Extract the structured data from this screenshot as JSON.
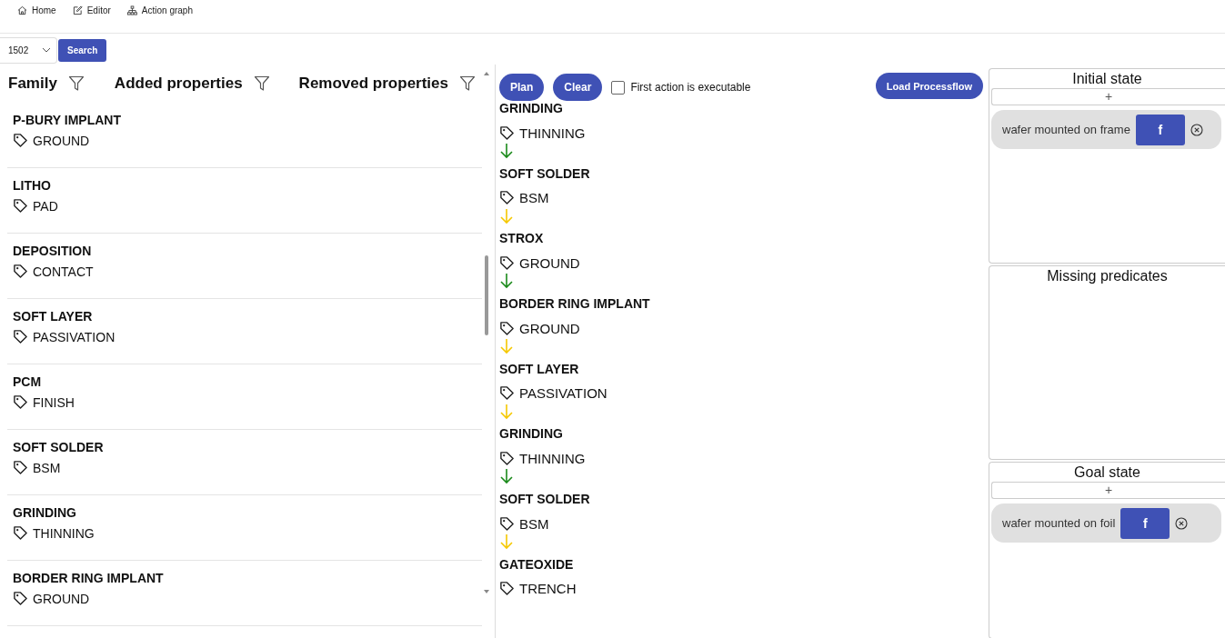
{
  "nav": [
    {
      "label": "Home"
    },
    {
      "label": "Editor"
    },
    {
      "label": "Action graph"
    }
  ],
  "search": {
    "value": "1502",
    "button": "Search"
  },
  "table": {
    "columns": [
      "Family",
      "Added properties",
      "Removed properties"
    ],
    "rows": [
      {
        "family": "P-BURY IMPLANT",
        "tag": "GROUND"
      },
      {
        "family": "LITHO",
        "tag": "PAD"
      },
      {
        "family": "DEPOSITION",
        "tag": "CONTACT"
      },
      {
        "family": "SOFT LAYER",
        "tag": "PASSIVATION"
      },
      {
        "family": "PCM",
        "tag": "FINISH"
      },
      {
        "family": "SOFT SOLDER",
        "tag": "BSM"
      },
      {
        "family": "GRINDING",
        "tag": "THINNING"
      },
      {
        "family": "BORDER RING IMPLANT",
        "tag": "GROUND"
      }
    ]
  },
  "toolbar": {
    "plan": "Plan",
    "clear": "Clear",
    "checkbox": {
      "label": "First action is executable",
      "checked": false
    },
    "load": "Load Processflow"
  },
  "plan_steps": [
    {
      "family": "GRINDING",
      "tag": "THINNING",
      "color": "#1b8a1b"
    },
    {
      "family": "SOFT SOLDER",
      "tag": "BSM",
      "color": "#f5c800"
    },
    {
      "family": "STROX",
      "tag": "GROUND",
      "color": "#1b8a1b"
    },
    {
      "family": "BORDER RING IMPLANT",
      "tag": "GROUND",
      "color": "#f5c800"
    },
    {
      "family": "SOFT LAYER",
      "tag": "PASSIVATION",
      "color": "#f5c800"
    },
    {
      "family": "GRINDING",
      "tag": "THINNING",
      "color": "#1b8a1b"
    },
    {
      "family": "SOFT SOLDER",
      "tag": "BSM",
      "color": "#f5c800"
    },
    {
      "family": "GATEOXIDE",
      "tag": "TRENCH"
    }
  ],
  "initial_state": {
    "title": "Initial state",
    "add": "+",
    "predicates": [
      {
        "label": "wafer mounted on frame",
        "value": "f"
      }
    ]
  },
  "missing_predicates": {
    "title": "Missing predicates"
  },
  "goal_state": {
    "title": "Goal state",
    "add": "+",
    "predicates": [
      {
        "label": "wafer mounted on foil",
        "value": "f"
      }
    ]
  }
}
